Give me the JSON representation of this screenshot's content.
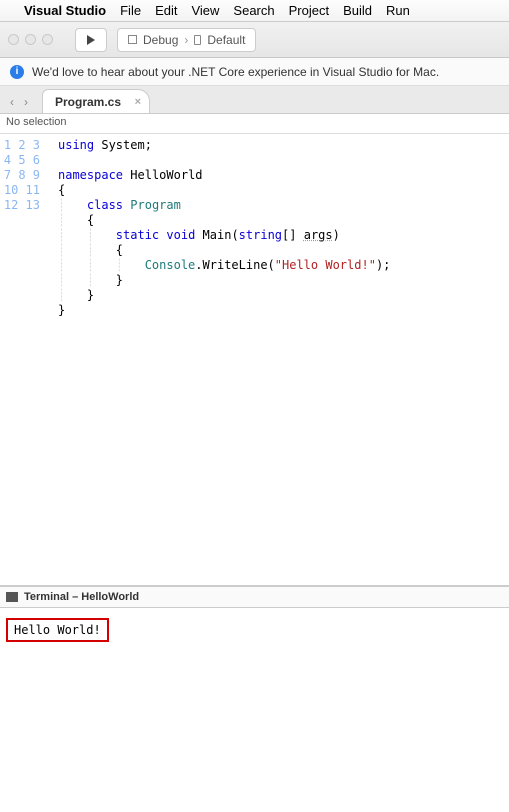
{
  "menubar": {
    "appname": "Visual Studio",
    "items": [
      "File",
      "Edit",
      "View",
      "Search",
      "Project",
      "Build",
      "Run"
    ]
  },
  "toolbar": {
    "config_label": "Debug",
    "target_label": "Default"
  },
  "notice": {
    "text": "We'd love to hear about your .NET Core experience in Visual Studio for Mac."
  },
  "tabs": {
    "active": {
      "title": "Program.cs"
    }
  },
  "subbar": {
    "text": "No selection"
  },
  "editor": {
    "line_count": 13,
    "tokens": {
      "using": "using",
      "system": "System",
      "namespace": "namespace",
      "ns_name": "HelloWorld",
      "class": "class",
      "class_name": "Program",
      "static": "static",
      "void": "void",
      "main": "Main",
      "string": "string",
      "brackets": "[]",
      "args": "args",
      "console": "Console",
      "writeline": "WriteLine",
      "hello_str": "\"Hello World!\"",
      "ob": "{",
      "cb": "}",
      "sc": ";",
      "op": "(",
      "cp": ")",
      "dot": "."
    }
  },
  "terminal": {
    "title": "Terminal – HelloWorld",
    "output": "Hello World!"
  }
}
